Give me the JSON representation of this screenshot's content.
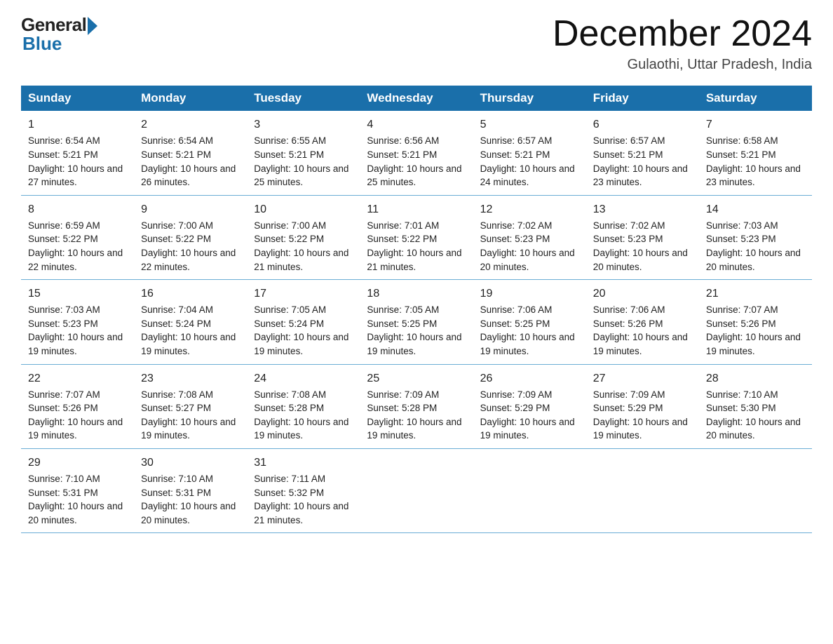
{
  "logo": {
    "general": "General",
    "blue": "Blue"
  },
  "title": "December 2024",
  "subtitle": "Gulaothi, Uttar Pradesh, India",
  "days": [
    "Sunday",
    "Monday",
    "Tuesday",
    "Wednesday",
    "Thursday",
    "Friday",
    "Saturday"
  ],
  "weeks": [
    [
      {
        "num": "1",
        "sunrise": "6:54 AM",
        "sunset": "5:21 PM",
        "daylight": "10 hours and 27 minutes."
      },
      {
        "num": "2",
        "sunrise": "6:54 AM",
        "sunset": "5:21 PM",
        "daylight": "10 hours and 26 minutes."
      },
      {
        "num": "3",
        "sunrise": "6:55 AM",
        "sunset": "5:21 PM",
        "daylight": "10 hours and 25 minutes."
      },
      {
        "num": "4",
        "sunrise": "6:56 AM",
        "sunset": "5:21 PM",
        "daylight": "10 hours and 25 minutes."
      },
      {
        "num": "5",
        "sunrise": "6:57 AM",
        "sunset": "5:21 PM",
        "daylight": "10 hours and 24 minutes."
      },
      {
        "num": "6",
        "sunrise": "6:57 AM",
        "sunset": "5:21 PM",
        "daylight": "10 hours and 23 minutes."
      },
      {
        "num": "7",
        "sunrise": "6:58 AM",
        "sunset": "5:21 PM",
        "daylight": "10 hours and 23 minutes."
      }
    ],
    [
      {
        "num": "8",
        "sunrise": "6:59 AM",
        "sunset": "5:22 PM",
        "daylight": "10 hours and 22 minutes."
      },
      {
        "num": "9",
        "sunrise": "7:00 AM",
        "sunset": "5:22 PM",
        "daylight": "10 hours and 22 minutes."
      },
      {
        "num": "10",
        "sunrise": "7:00 AM",
        "sunset": "5:22 PM",
        "daylight": "10 hours and 21 minutes."
      },
      {
        "num": "11",
        "sunrise": "7:01 AM",
        "sunset": "5:22 PM",
        "daylight": "10 hours and 21 minutes."
      },
      {
        "num": "12",
        "sunrise": "7:02 AM",
        "sunset": "5:23 PM",
        "daylight": "10 hours and 20 minutes."
      },
      {
        "num": "13",
        "sunrise": "7:02 AM",
        "sunset": "5:23 PM",
        "daylight": "10 hours and 20 minutes."
      },
      {
        "num": "14",
        "sunrise": "7:03 AM",
        "sunset": "5:23 PM",
        "daylight": "10 hours and 20 minutes."
      }
    ],
    [
      {
        "num": "15",
        "sunrise": "7:03 AM",
        "sunset": "5:23 PM",
        "daylight": "10 hours and 19 minutes."
      },
      {
        "num": "16",
        "sunrise": "7:04 AM",
        "sunset": "5:24 PM",
        "daylight": "10 hours and 19 minutes."
      },
      {
        "num": "17",
        "sunrise": "7:05 AM",
        "sunset": "5:24 PM",
        "daylight": "10 hours and 19 minutes."
      },
      {
        "num": "18",
        "sunrise": "7:05 AM",
        "sunset": "5:25 PM",
        "daylight": "10 hours and 19 minutes."
      },
      {
        "num": "19",
        "sunrise": "7:06 AM",
        "sunset": "5:25 PM",
        "daylight": "10 hours and 19 minutes."
      },
      {
        "num": "20",
        "sunrise": "7:06 AM",
        "sunset": "5:26 PM",
        "daylight": "10 hours and 19 minutes."
      },
      {
        "num": "21",
        "sunrise": "7:07 AM",
        "sunset": "5:26 PM",
        "daylight": "10 hours and 19 minutes."
      }
    ],
    [
      {
        "num": "22",
        "sunrise": "7:07 AM",
        "sunset": "5:26 PM",
        "daylight": "10 hours and 19 minutes."
      },
      {
        "num": "23",
        "sunrise": "7:08 AM",
        "sunset": "5:27 PM",
        "daylight": "10 hours and 19 minutes."
      },
      {
        "num": "24",
        "sunrise": "7:08 AM",
        "sunset": "5:28 PM",
        "daylight": "10 hours and 19 minutes."
      },
      {
        "num": "25",
        "sunrise": "7:09 AM",
        "sunset": "5:28 PM",
        "daylight": "10 hours and 19 minutes."
      },
      {
        "num": "26",
        "sunrise": "7:09 AM",
        "sunset": "5:29 PM",
        "daylight": "10 hours and 19 minutes."
      },
      {
        "num": "27",
        "sunrise": "7:09 AM",
        "sunset": "5:29 PM",
        "daylight": "10 hours and 19 minutes."
      },
      {
        "num": "28",
        "sunrise": "7:10 AM",
        "sunset": "5:30 PM",
        "daylight": "10 hours and 20 minutes."
      }
    ],
    [
      {
        "num": "29",
        "sunrise": "7:10 AM",
        "sunset": "5:31 PM",
        "daylight": "10 hours and 20 minutes."
      },
      {
        "num": "30",
        "sunrise": "7:10 AM",
        "sunset": "5:31 PM",
        "daylight": "10 hours and 20 minutes."
      },
      {
        "num": "31",
        "sunrise": "7:11 AM",
        "sunset": "5:32 PM",
        "daylight": "10 hours and 21 minutes."
      },
      null,
      null,
      null,
      null
    ]
  ]
}
